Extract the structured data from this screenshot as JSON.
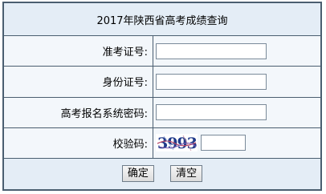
{
  "form": {
    "title": "2017年陕西省高考成绩查询",
    "fields": [
      {
        "label": "准考证号:",
        "value": ""
      },
      {
        "label": "身份证号:",
        "value": ""
      },
      {
        "label": "高考报名系统密码:",
        "value": ""
      }
    ],
    "captcha": {
      "label": "校验码:",
      "code": "3993",
      "value": ""
    },
    "buttons": {
      "confirm": "确定",
      "clear": "清空"
    }
  }
}
